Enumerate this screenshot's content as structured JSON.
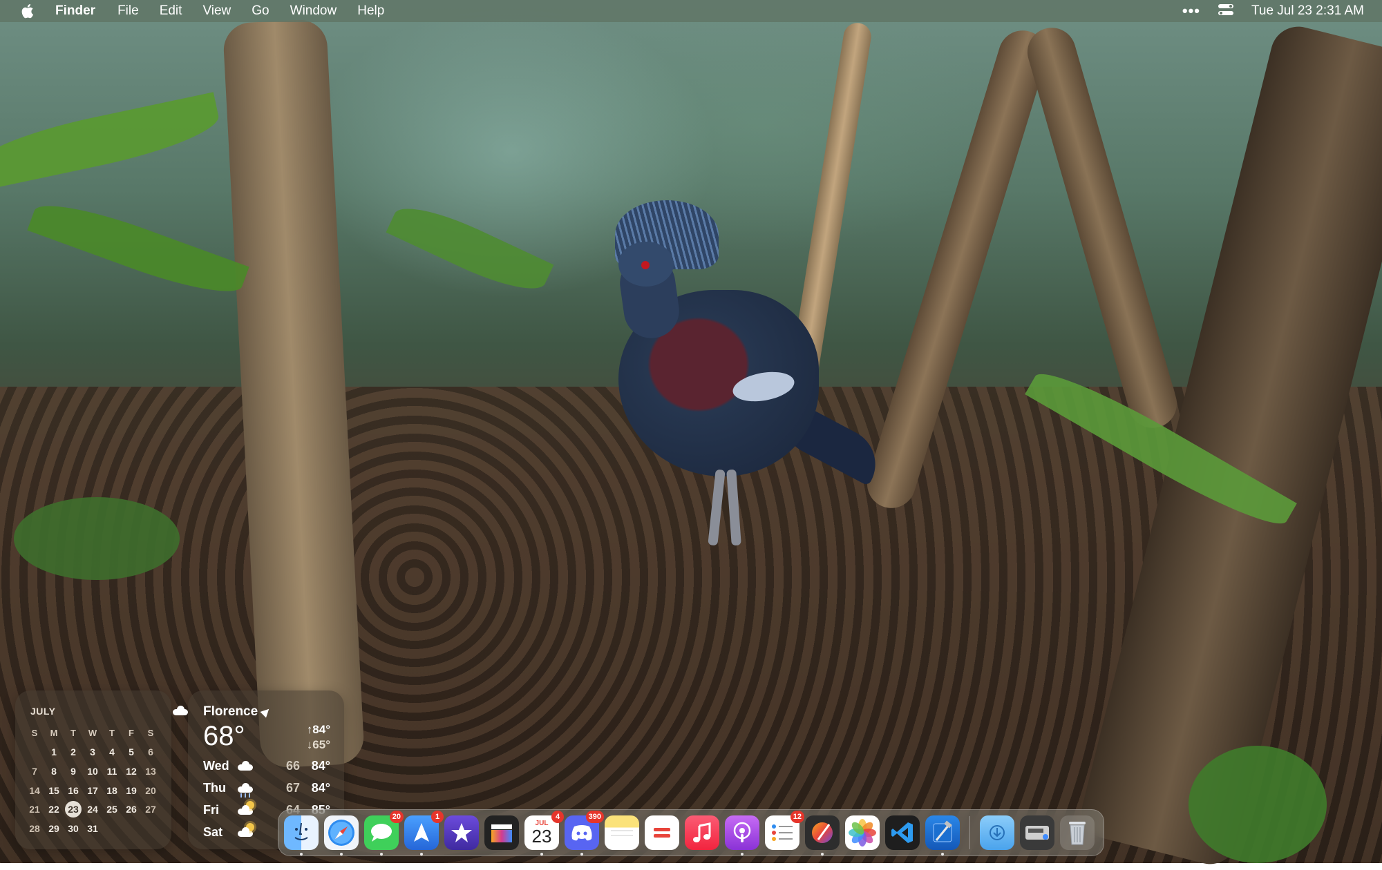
{
  "menubar": {
    "app_name": "Finder",
    "menus": [
      "File",
      "Edit",
      "View",
      "Go",
      "Window",
      "Help"
    ],
    "datetime": "Tue Jul 23  2:31 AM",
    "overflow": "•••"
  },
  "calendar_widget": {
    "month": "JULY",
    "weekdays": [
      "S",
      "M",
      "T",
      "W",
      "T",
      "F",
      "S"
    ],
    "weeks": [
      [
        "",
        "1",
        "2",
        "3",
        "4",
        "5",
        "6"
      ],
      [
        "7",
        "8",
        "9",
        "10",
        "11",
        "12",
        "13"
      ],
      [
        "14",
        "15",
        "16",
        "17",
        "18",
        "19",
        "20"
      ],
      [
        "21",
        "22",
        "23",
        "24",
        "25",
        "26",
        "27"
      ],
      [
        "28",
        "29",
        "30",
        "31",
        "",
        "",
        ""
      ]
    ],
    "today": "23"
  },
  "weather_widget": {
    "city": "Florence",
    "temp": "68°",
    "high": "↑84°",
    "low": "↓65°",
    "forecast": [
      {
        "day": "Wed",
        "low": "66",
        "high": "84°",
        "icon": "cloud-icon"
      },
      {
        "day": "Thu",
        "low": "67",
        "high": "84°",
        "icon": "rain-cloud-icon"
      },
      {
        "day": "Fri",
        "low": "64",
        "high": "85°",
        "icon": "sun-cloud-icon"
      },
      {
        "day": "Sat",
        "low": "",
        "high": "",
        "icon": "sun-cloud-icon"
      }
    ]
  },
  "dock": {
    "calendar_month": "JUL",
    "calendar_day": "23",
    "badges": {
      "messages": "20",
      "testflight": "1",
      "calendar": "4",
      "discord": "390",
      "reminders": "12"
    },
    "apps": [
      "Finder",
      "Safari",
      "Messages",
      "TestFlight",
      "iMovie",
      "Final Cut Pro",
      "Calendar",
      "Discord",
      "Notes",
      "Soulver",
      "Music",
      "Podcasts",
      "Reminders",
      "Pixelmator Pro",
      "Photos",
      "Visual Studio Code",
      "Xcode",
      "Downloads",
      "Disk Utility",
      "Trash"
    ]
  }
}
